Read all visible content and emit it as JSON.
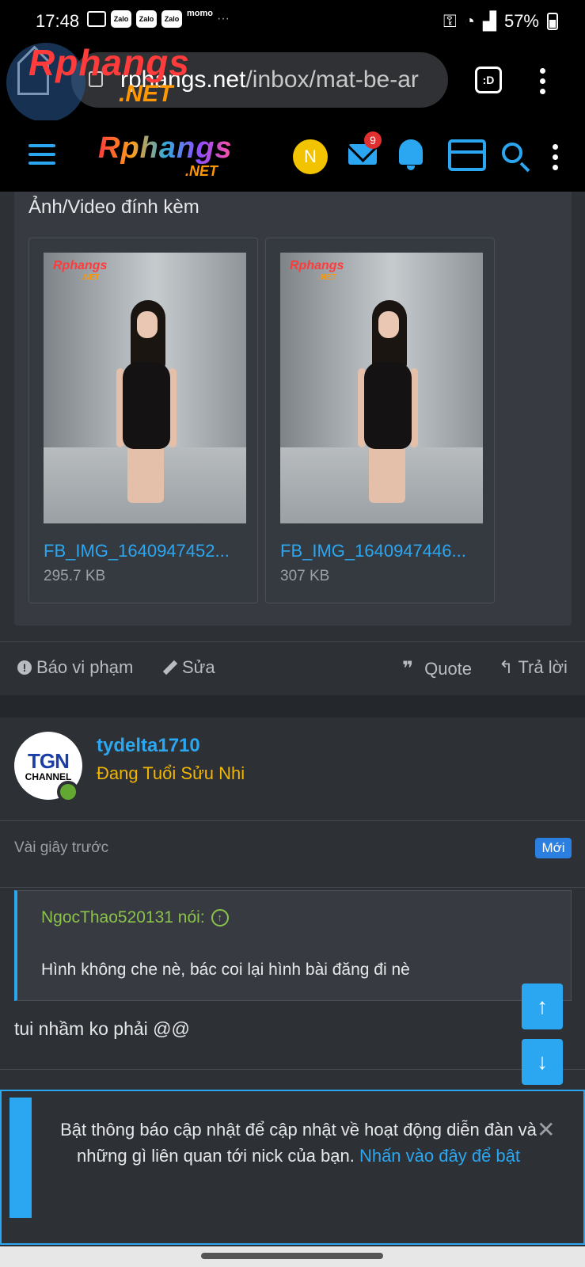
{
  "status_bar": {
    "time": "17:48",
    "notification_icons": [
      "chat-icon",
      "Zalo",
      "Zalo",
      "Zalo",
      "momo"
    ],
    "overflow": "···",
    "battery": "57%",
    "icons": [
      "key-icon",
      "wifi-icon",
      "signal-icon",
      "battery-icon"
    ]
  },
  "browser": {
    "url_host": "rphangs.net",
    "url_path": "/inbox/mat-be-ar",
    "tab_label": ":D",
    "watermark_logo": "Rphangs",
    "watermark_logo_suffix": ".NET"
  },
  "site_header": {
    "logo_main": "Rphangs",
    "logo_suffix": ".NET",
    "avatar_letter": "N",
    "inbox_badge": "9",
    "icons": [
      "menu-icon",
      "mail-icon",
      "bell-icon",
      "store-icon",
      "search-icon",
      "more-icon"
    ]
  },
  "attachments": {
    "title": "Ảnh/Video đính kèm",
    "items": [
      {
        "name": "FB_IMG_1640947452...",
        "size": "295.7 KB"
      },
      {
        "name": "FB_IMG_1640947446...",
        "size": "307 KB"
      }
    ],
    "thumb_watermark": "Rphangs",
    "thumb_watermark_suffix": ".NET"
  },
  "post_actions": {
    "report": "Báo vi phạm",
    "edit": "Sửa",
    "quote": "Quote",
    "reply": "Trả lời"
  },
  "post": {
    "avatar_text_1": "TGN",
    "avatar_text_2": "CHANNEL",
    "username": "tydelta1710",
    "user_title": "Đang Tuổi Sửu Nhi",
    "time": "Vài giây trước",
    "new_badge": "Mới",
    "quote_author": "NgocThao520131 nói:",
    "quote_text": "Hình không che nè, bác coi lại hình bài đăng đi nè",
    "body": "tui nhầm ko phải @@"
  },
  "scroll": {
    "up": "↑",
    "down": "↓"
  },
  "push_prompt": {
    "text": "Bật thông báo cập nhật để cập nhật về hoạt động diễn đàn và những gì liên quan tới nick của bạn.",
    "link": "Nhấn vào đây để bật",
    "close": "✕"
  },
  "colors": {
    "accent": "#2ba6f0",
    "background": "#2d3035",
    "user_title": "#f2b600",
    "quote_author": "#8bc34a"
  }
}
